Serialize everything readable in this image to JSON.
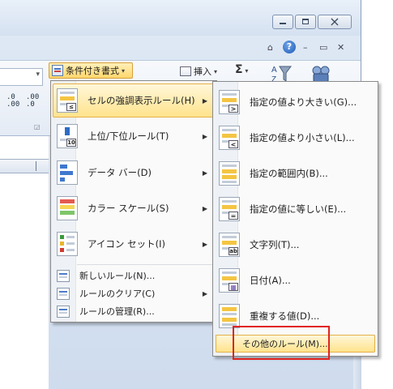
{
  "ribbon": {
    "conditional_formatting_label": "条件付き書式",
    "insert_label": "挿入",
    "sigma_label": "Σ",
    "decimal_increase": ".0\n.00",
    "decimal_decrease": ".00\n.0",
    "help_label": "?"
  },
  "main_menu": {
    "items": [
      {
        "label": "セルの強調表示ルール(H)",
        "icon": "highlight-cells-rules-icon"
      },
      {
        "label": "上位/下位ルール(T)",
        "icon": "top-bottom-rules-icon"
      },
      {
        "label": "データ バー(D)",
        "icon": "data-bars-icon"
      },
      {
        "label": "カラー スケール(S)",
        "icon": "color-scales-icon"
      },
      {
        "label": "アイコン セット(I)",
        "icon": "icon-sets-icon"
      }
    ],
    "small_items": [
      {
        "label": "新しいルール(N)...",
        "icon": "new-rule-icon"
      },
      {
        "label": "ルールのクリア(C)",
        "icon": "clear-rules-icon"
      },
      {
        "label": "ルールの管理(R)...",
        "icon": "manage-rules-icon"
      }
    ]
  },
  "sub_menu": {
    "items": [
      {
        "label": "指定の値より大きい(G)...",
        "symbol": ">"
      },
      {
        "label": "指定の値より小さい(L)...",
        "symbol": "<"
      },
      {
        "label": "指定の範囲内(B)...",
        "symbol": ""
      },
      {
        "label": "指定の値に等しい(E)...",
        "symbol": "="
      },
      {
        "label": "文字列(T)...",
        "symbol": "ab"
      },
      {
        "label": "日付(A)...",
        "symbol": "▦"
      },
      {
        "label": "重複する値(D)...",
        "symbol": ""
      }
    ],
    "more_rules": {
      "label": "その他のルール(M)..."
    }
  },
  "colors": {
    "highlight_border": "#e4b04a",
    "highlight_fill": "#ffe38c",
    "annotation_box": "#e1231f"
  }
}
